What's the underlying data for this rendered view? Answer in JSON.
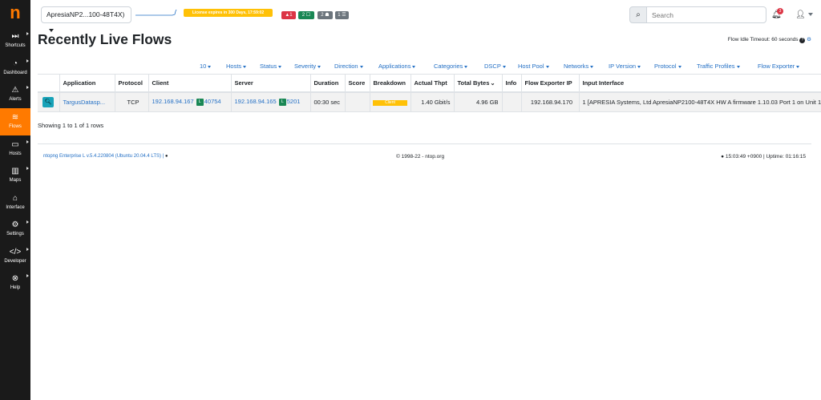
{
  "sidebar": {
    "logo": "n",
    "items": [
      {
        "label": "Shortcuts",
        "icon": "fast-forward-icon",
        "glyph": "⏭",
        "caret": true
      },
      {
        "label": "Dashboard",
        "icon": "speedometer-icon",
        "glyph": "◔",
        "caret": true
      },
      {
        "label": "Alerts",
        "icon": "warning-icon",
        "glyph": "⚠",
        "caret": true
      },
      {
        "label": "Flows",
        "icon": "stream-icon",
        "glyph": "≋",
        "caret": false,
        "active": true
      },
      {
        "label": "Hosts",
        "icon": "laptop-icon",
        "glyph": "▭",
        "caret": true
      },
      {
        "label": "Maps",
        "icon": "map-icon",
        "glyph": "▥",
        "caret": true
      },
      {
        "label": "Interface",
        "icon": "ethernet-icon",
        "glyph": "⌂",
        "caret": false
      },
      {
        "label": "Settings",
        "icon": "gear-icon",
        "glyph": "⚙",
        "caret": true
      },
      {
        "label": "Developer",
        "icon": "code-icon",
        "glyph": "</>",
        "caret": true
      },
      {
        "label": "Help",
        "icon": "life-ring-icon",
        "glyph": "⊗",
        "caret": true
      }
    ]
  },
  "header": {
    "interface": "ApresiaNP2...100-48T4X)",
    "license": "License expires in 300 Days, 17:59:02",
    "badges": [
      {
        "text": "▲1",
        "color": "#dc3545"
      },
      {
        "text": "2 ☐",
        "color": "#198754"
      },
      {
        "text": "2 ☗",
        "color": "#6c757d"
      },
      {
        "text": "1 ☰",
        "color": "#6c757d"
      }
    ],
    "search_placeholder": "Search",
    "notifications": "3"
  },
  "page": {
    "title": "Recently Live Flows",
    "idle_timeout": "Flow Idle Timeout: 60 seconds"
  },
  "filters": [
    "10",
    "Hosts",
    "Status",
    "Severity",
    "Direction",
    "Applications",
    "Categories",
    "DSCP",
    "Host Pool",
    "Networks",
    "IP Version",
    "Protocol",
    "Traffic Profiles",
    "Flow Exporter"
  ],
  "table": {
    "columns": [
      "",
      "Application",
      "Protocol",
      "Client",
      "Server",
      "Duration",
      "Score",
      "Breakdown",
      "Actual Thpt",
      "Total Bytes",
      "Info",
      "Flow Exporter IP",
      "Input Interface"
    ],
    "rows": [
      {
        "application": "TargusDatasp...",
        "protocol": "TCP",
        "client_ip": "192.168.94.167",
        "client_badge": "L",
        "client_port": "40754",
        "server_ip": "192.168.94.165",
        "server_badge": "L",
        "server_port": "5201",
        "duration": "00:30 sec",
        "score": "",
        "breakdown": "Client",
        "thpt": "1.40 Gbit/s",
        "bytes": "4.96 GB",
        "info": "",
        "exporter_ip": "192.168.94.170",
        "input_interface": "1 [APRESIA Systems, Ltd ApresiaNP2100-48T4X HW A firmware 1.10.03 Port 1 on Unit 1]"
      }
    ]
  },
  "showing": "Showing 1 to 1 of 1 rows",
  "footer": {
    "version": "ntopng Enterprise L v.5.4.220804 (Ubuntu 20.04.4 LTS) |",
    "copyright": "© 1998-22 - ntop.org",
    "clock": "15:03:49 +0900 | Uptime: 01:16:15"
  }
}
